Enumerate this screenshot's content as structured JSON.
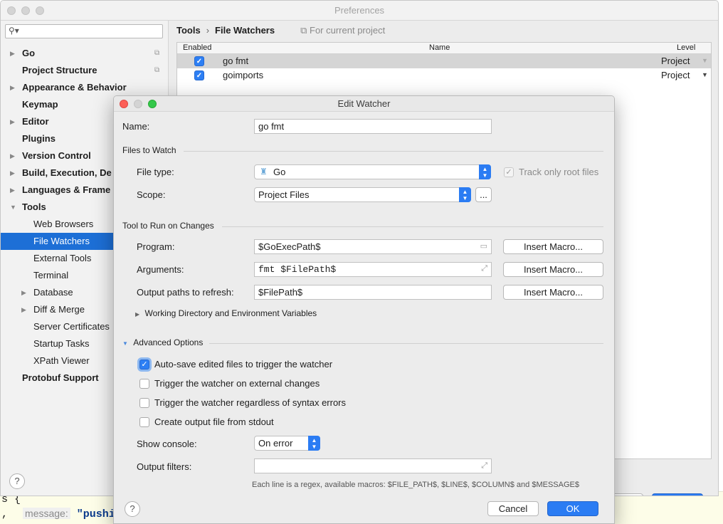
{
  "background_editor": {
    "line1": "s {",
    "line2_prefix": ",",
    "hint": "message:",
    "string_value": "\"pushi"
  },
  "preferences": {
    "title": "Preferences",
    "search_placeholder": "",
    "sidebar": [
      {
        "label": "Go",
        "arrow": "▶",
        "proj": "⧉"
      },
      {
        "label": "Project Structure",
        "arrow": "",
        "proj": "⧉"
      },
      {
        "label": "Appearance & Behavior",
        "arrow": "▶",
        "proj": ""
      },
      {
        "label": "Keymap",
        "arrow": "",
        "proj": ""
      },
      {
        "label": "Editor",
        "arrow": "▶",
        "proj": ""
      },
      {
        "label": "Plugins",
        "arrow": "",
        "proj": ""
      },
      {
        "label": "Version Control",
        "arrow": "▶",
        "proj": ""
      },
      {
        "label": "Build, Execution, De",
        "arrow": "▶",
        "proj": ""
      },
      {
        "label": "Languages & Frame",
        "arrow": "▶",
        "proj": ""
      },
      {
        "label": "Tools",
        "arrow": "▼",
        "proj": ""
      },
      {
        "label": "Web Browsers",
        "arrow": "",
        "child": true
      },
      {
        "label": "File Watchers",
        "arrow": "",
        "child": true,
        "selected": true
      },
      {
        "label": "External Tools",
        "arrow": "",
        "child": true
      },
      {
        "label": "Terminal",
        "arrow": "",
        "child": true
      },
      {
        "label": "Database",
        "arrow": "▶",
        "child": true
      },
      {
        "label": "Diff & Merge",
        "arrow": "▶",
        "child": true
      },
      {
        "label": "Server Certificates",
        "arrow": "",
        "child": true
      },
      {
        "label": "Startup Tasks",
        "arrow": "",
        "child": true
      },
      {
        "label": "XPath Viewer",
        "arrow": "",
        "child": true
      },
      {
        "label": "Protobuf Support",
        "arrow": "",
        "proj": ""
      }
    ],
    "help_label": "?",
    "breadcrumb": {
      "root": "Tools",
      "separator": "›",
      "current": "File Watchers",
      "scope_icon": "⧉",
      "scope": "For current project"
    },
    "table": {
      "headers": {
        "enabled": "Enabled",
        "name": "Name",
        "level": "Level"
      },
      "rows": [
        {
          "checked": "✓",
          "name": "go fmt",
          "level": "Project",
          "arrow": "▼"
        },
        {
          "checked": "✓",
          "name": "goimports",
          "level": "Project",
          "arrow": "▼"
        }
      ]
    },
    "apply_label": "pply",
    "ok_label": "OK"
  },
  "dialog": {
    "title": "Edit Watcher",
    "name_label": "Name:",
    "name_value": "go fmt",
    "files_section": "Files to Watch",
    "file_type_label": "File type:",
    "file_type_value": "Go",
    "file_type_icon": "gopher-icon",
    "track_root_label": "Track only root files",
    "track_root_check": "✓",
    "scope_label": "Scope:",
    "scope_value": "Project Files",
    "scope_more": "...",
    "tool_section": "Tool to Run on Changes",
    "program_label": "Program:",
    "program_value": "$GoExecPath$",
    "arguments_label": "Arguments:",
    "arguments_value": "fmt $FilePath$",
    "output_paths_label": "Output paths to refresh:",
    "output_paths_value": "$FilePath$",
    "insert_macro": "Insert Macro...",
    "working_dir_label": "Working Directory and Environment Variables",
    "advanced_section": "Advanced Options",
    "options": [
      {
        "label": "Auto-save edited files to trigger the watcher",
        "checked": true
      },
      {
        "label": "Trigger the watcher on external changes",
        "checked": false
      },
      {
        "label": "Trigger the watcher regardless of syntax errors",
        "checked": false
      },
      {
        "label": "Create output file from stdout",
        "checked": false
      }
    ],
    "check_mark": "✓",
    "show_console_label": "Show console:",
    "show_console_value": "On error",
    "output_filters_label": "Output filters:",
    "output_filters_value": "",
    "filters_hint": "Each line is a regex, available macros: $FILE_PATH$, $LINE$, $COLUMN$ and $MESSAGE$",
    "help_label": "?",
    "cancel_label": "Cancel",
    "ok_label": "OK",
    "stepper_up": "▲",
    "stepper_down": "▼",
    "folder_glyph": "▭",
    "expand_glyph": "⤢",
    "collapse_glyph": "▶",
    "expanded_glyph": "▼"
  },
  "colors": {
    "accent": "#2b7cf3",
    "selection": "#1d6fd6"
  }
}
